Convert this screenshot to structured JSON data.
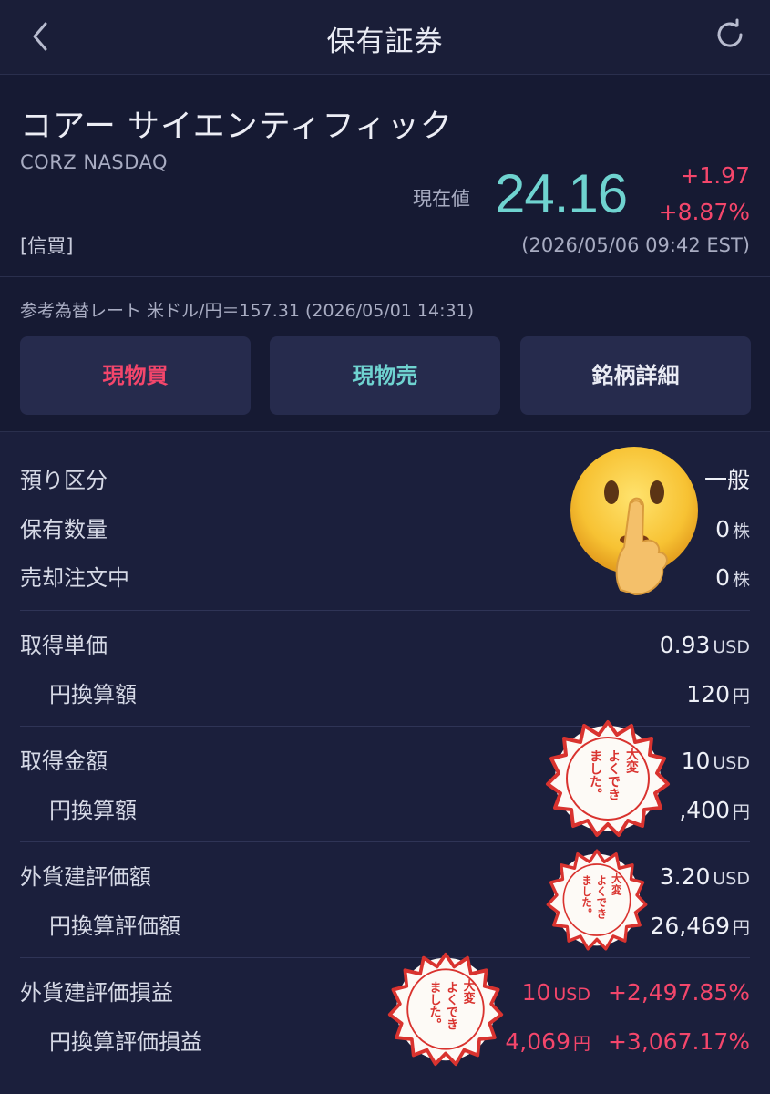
{
  "header": {
    "title": "保有証券"
  },
  "stock": {
    "name": "コアー サイエンティフィック",
    "ticker": "CORZ NASDAQ",
    "margin_tag": "[信買]",
    "price_label": "現在値",
    "price": "24.16",
    "change_abs": "+1.97",
    "change_pct": "+8.87%",
    "timestamp": "(2026/05/06 09:42 EST)"
  },
  "exchange_rate": "参考為替レート 米ドル/円＝157.31 (2026/05/01 14:31)",
  "actions": {
    "buy": "現物買",
    "sell": "現物売",
    "detail": "銘柄詳細"
  },
  "holdings": {
    "account_type": {
      "label": "預り区分",
      "value": "一般"
    },
    "quantity": {
      "label": "保有数量",
      "value": "0",
      "unit": "株"
    },
    "selling_orders": {
      "label": "売却注文中",
      "value": "0",
      "unit": "株"
    },
    "avg_cost": {
      "label": "取得単価",
      "value": "0.93",
      "unit": "USD"
    },
    "avg_cost_jpy": {
      "label": "円換算額",
      "value": "120",
      "unit": "円"
    },
    "cost_total": {
      "label": "取得金額",
      "value": "10",
      "unit": "USD"
    },
    "cost_total_jpy": {
      "label": "円換算額",
      "value": ",400",
      "unit": "円"
    },
    "fx_value": {
      "label": "外貨建評価額",
      "value": "3.20",
      "unit": "USD"
    },
    "jpy_value": {
      "label": "円換算評価額",
      "value": "26,469",
      "unit": "円"
    },
    "fx_pl": {
      "label": "外貨建評価損益",
      "value": "10",
      "unit": "USD",
      "pct": "+2,497.85%"
    },
    "jpy_pl": {
      "label": "円換算評価損益",
      "value": "4,069",
      "unit": "円",
      "pct": "+3,067.17%"
    }
  },
  "stamp_text": {
    "line1": "大変",
    "line2": "よくでき",
    "line3": "ました。"
  },
  "colors": {
    "accent_red": "#f4466b",
    "accent_teal": "#6fd3d0",
    "background": "#161a33",
    "stamp_red": "#d9332f"
  }
}
